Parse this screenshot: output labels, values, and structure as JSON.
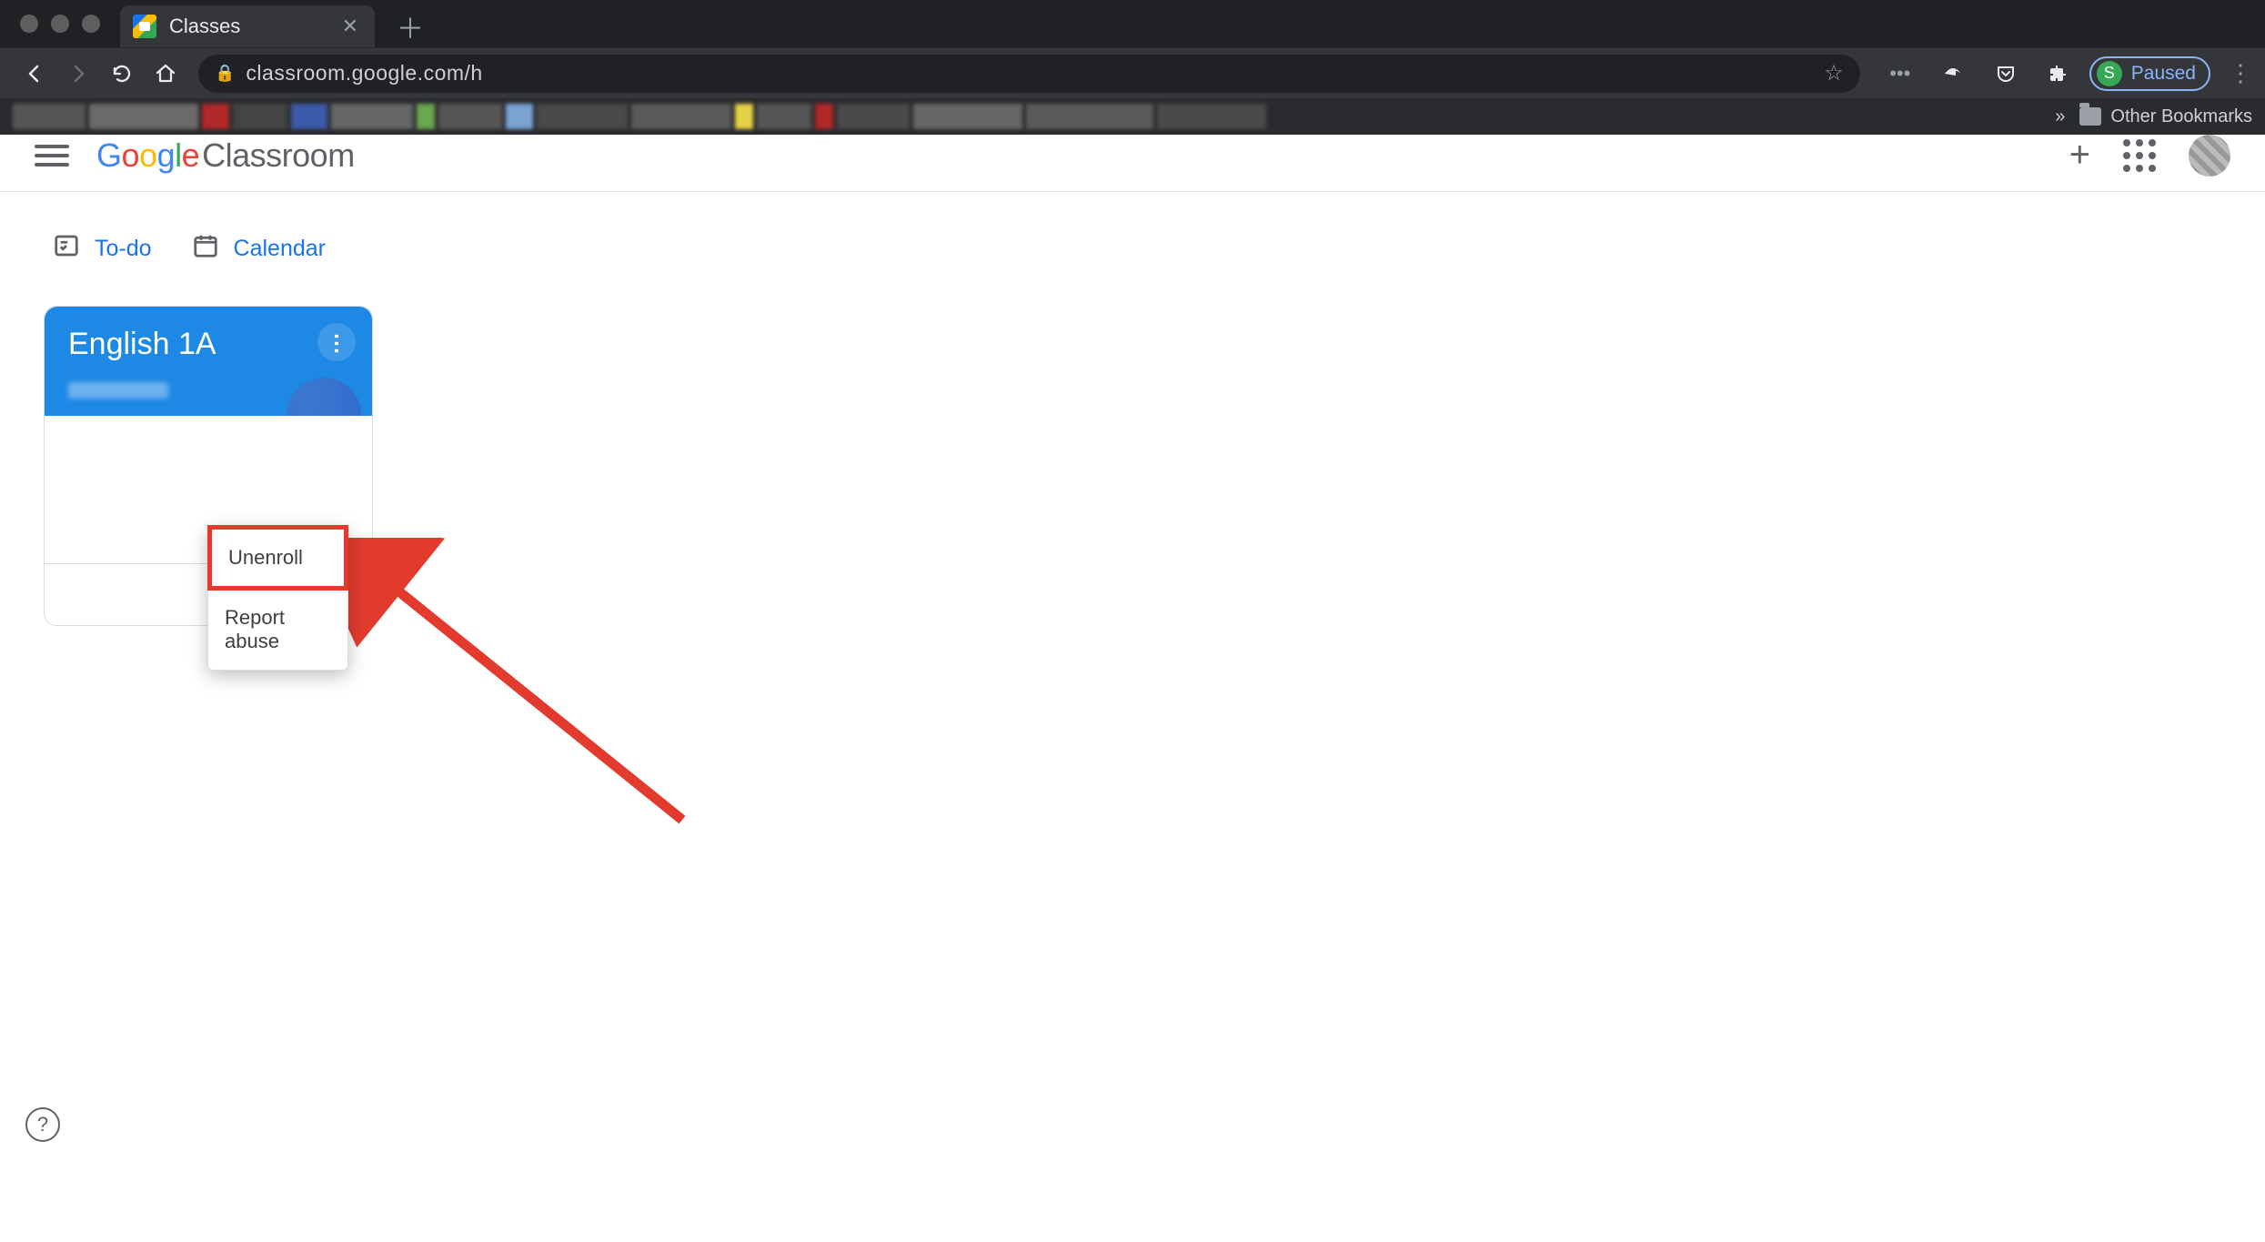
{
  "browser": {
    "tab": {
      "title": "Classes"
    },
    "url": "classroom.google.com/h",
    "profile": {
      "initial": "S",
      "status": "Paused"
    },
    "bookmarks": {
      "overflow": "»",
      "other_label": "Other Bookmarks"
    }
  },
  "app": {
    "logo": {
      "g1": "G",
      "g2": "o",
      "g3": "o",
      "g4": "g",
      "g5": "l",
      "g6": "e",
      "product": "Classroom"
    },
    "quick": {
      "todo": "To-do",
      "calendar": "Calendar"
    },
    "class": {
      "title": "English 1A",
      "menu": {
        "unenroll": "Unenroll",
        "report": "Report abuse"
      }
    },
    "help_glyph": "?"
  }
}
